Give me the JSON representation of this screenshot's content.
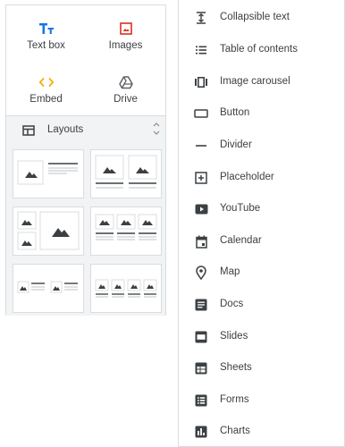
{
  "insert": {
    "items": [
      {
        "label": "Text box",
        "icon": "text-box-icon",
        "color": "#1a73e8"
      },
      {
        "label": "Images",
        "icon": "image-icon",
        "color": "#d93025"
      },
      {
        "label": "Embed",
        "icon": "embed-code-icon",
        "color": "#f9ab00"
      },
      {
        "label": "Drive",
        "icon": "drive-icon",
        "color": "#5f6368"
      }
    ]
  },
  "layouts": {
    "title": "Layouts",
    "icon": "layouts-icon",
    "collapse_icon": "chevron-collapse-icon",
    "cards": [
      {
        "name": "image-left-text-right"
      },
      {
        "name": "two-images-with-captions"
      },
      {
        "name": "three-images-grid"
      },
      {
        "name": "three-columns"
      },
      {
        "name": "image-text-pairs"
      },
      {
        "name": "four-columns"
      }
    ]
  },
  "components": {
    "items": [
      {
        "label": "Collapsible text",
        "icon": "collapsible-text-icon"
      },
      {
        "label": "Table of contents",
        "icon": "table-of-contents-icon"
      },
      {
        "label": "Image carousel",
        "icon": "image-carousel-icon"
      },
      {
        "label": "Button",
        "icon": "button-icon"
      },
      {
        "label": "Divider",
        "icon": "divider-icon"
      },
      {
        "label": "Placeholder",
        "icon": "placeholder-icon"
      },
      {
        "label": "YouTube",
        "icon": "youtube-icon"
      },
      {
        "label": "Calendar",
        "icon": "calendar-icon"
      },
      {
        "label": "Map",
        "icon": "map-pin-icon"
      },
      {
        "label": "Docs",
        "icon": "docs-icon"
      },
      {
        "label": "Slides",
        "icon": "slides-icon"
      },
      {
        "label": "Sheets",
        "icon": "sheets-icon"
      },
      {
        "label": "Forms",
        "icon": "forms-icon"
      },
      {
        "label": "Charts",
        "icon": "charts-icon"
      }
    ]
  },
  "colors": {
    "icon_gray": "#3c4043",
    "border": "#dadce0",
    "layouts_bg": "#f1f3f4"
  }
}
